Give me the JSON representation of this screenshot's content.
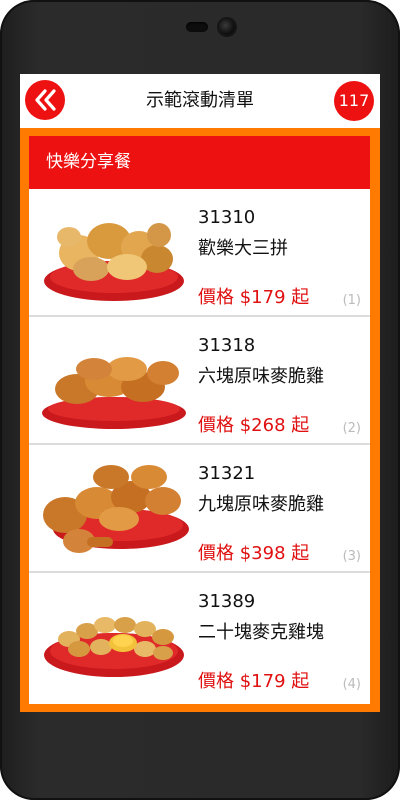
{
  "app": {
    "title": "示範滾動清單",
    "count": "117"
  },
  "section": {
    "title": "快樂分享餐"
  },
  "items": [
    {
      "code": "31310",
      "name": "歡樂大三拼",
      "price": "價格 $179 起",
      "index": "(1)",
      "image": "fried-chicken-platter"
    },
    {
      "code": "31318",
      "name": "六塊原味麥脆雞",
      "price": "價格 $268 起",
      "index": "(2)",
      "image": "six-pieces-fried-chicken"
    },
    {
      "code": "31321",
      "name": "九塊原味麥脆雞",
      "price": "價格 $398 起",
      "index": "(3)",
      "image": "nine-pieces-fried-chicken"
    },
    {
      "code": "31389",
      "name": "二十塊麥克雞塊",
      "price": "價格 $179 起",
      "index": "(4)",
      "image": "twenty-chicken-nuggets"
    }
  ],
  "colors": {
    "accent_red": "#ee1111",
    "frame_orange": "#ff7a00",
    "price_red": "#e01010",
    "phone_body": "#2a2a2a"
  },
  "icons": {
    "back": "double-chevron-left-icon"
  }
}
